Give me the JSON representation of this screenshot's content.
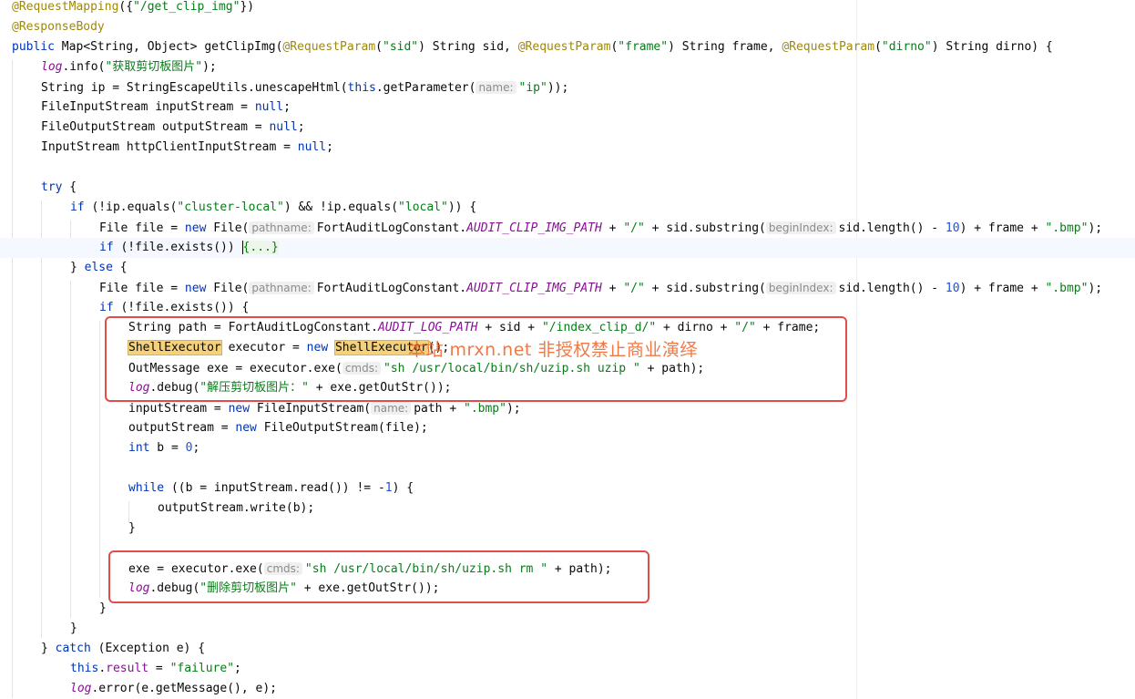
{
  "colors": {
    "keyword": "#0033b3",
    "string": "#067d17",
    "annotation": "#9e880d",
    "number": "#1750eb",
    "field": "#871094",
    "hint": "#8c8c8c",
    "highlight_box": "#e14d4d",
    "watermark": "#ec6226"
  },
  "watermark": {
    "text": "本站 mrxn.net 非授权禁止商业演绎"
  },
  "lines": [
    {
      "indent": 0,
      "tokens": [
        {
          "t": "@RequestMapping",
          "c": "ann"
        },
        {
          "t": "({"
        },
        {
          "t": "\"/get_clip_img\"",
          "c": "str"
        },
        {
          "t": "})"
        }
      ]
    },
    {
      "indent": 0,
      "tokens": [
        {
          "t": "@ResponseBody",
          "c": "ann"
        }
      ]
    },
    {
      "indent": 0,
      "tokens": [
        {
          "t": "public",
          "c": "kw"
        },
        {
          "t": " Map<String, Object> getClipImg("
        },
        {
          "t": "@RequestParam",
          "c": "ann"
        },
        {
          "t": "("
        },
        {
          "t": "\"sid\"",
          "c": "str"
        },
        {
          "t": ") String sid, "
        },
        {
          "t": "@RequestParam",
          "c": "ann"
        },
        {
          "t": "("
        },
        {
          "t": "\"frame\"",
          "c": "str"
        },
        {
          "t": ") String frame, "
        },
        {
          "t": "@RequestParam",
          "c": "ann"
        },
        {
          "t": "("
        },
        {
          "t": "\"dirno\"",
          "c": "str"
        },
        {
          "t": ") String dirno) {"
        }
      ]
    },
    {
      "indent": 1,
      "tokens": [
        {
          "t": "log",
          "c": "cst"
        },
        {
          "t": ".info("
        },
        {
          "t": "\"获取剪切板图片\"",
          "c": "str"
        },
        {
          "t": ");"
        }
      ]
    },
    {
      "indent": 1,
      "tokens": [
        {
          "t": "String ip = StringEscapeUtils.unescapeHtml("
        },
        {
          "t": "this",
          "c": "kw"
        },
        {
          "t": ".getParameter("
        },
        {
          "t": "name:",
          "c": "hint"
        },
        {
          "t": "\"ip\"",
          "c": "str"
        },
        {
          "t": "));"
        }
      ]
    },
    {
      "indent": 1,
      "tokens": [
        {
          "t": "FileInputStream inputStream = "
        },
        {
          "t": "null",
          "c": "kw"
        },
        {
          "t": ";"
        }
      ]
    },
    {
      "indent": 1,
      "tokens": [
        {
          "t": "FileOutputStream outputStream = "
        },
        {
          "t": "null",
          "c": "kw"
        },
        {
          "t": ";"
        }
      ]
    },
    {
      "indent": 1,
      "tokens": [
        {
          "t": "InputStream httpClientInputStream = "
        },
        {
          "t": "null",
          "c": "kw"
        },
        {
          "t": ";"
        }
      ]
    },
    {
      "indent": 0,
      "tokens": []
    },
    {
      "indent": 1,
      "tokens": [
        {
          "t": "try",
          "c": "kw"
        },
        {
          "t": " {"
        }
      ]
    },
    {
      "indent": 2,
      "tokens": [
        {
          "t": "if",
          "c": "kw"
        },
        {
          "t": " (!ip.equals("
        },
        {
          "t": "\"cluster-local\"",
          "c": "str"
        },
        {
          "t": ") && !ip.equals("
        },
        {
          "t": "\"local\"",
          "c": "str"
        },
        {
          "t": ")) {"
        }
      ]
    },
    {
      "indent": 3,
      "tokens": [
        {
          "t": "File file = "
        },
        {
          "t": "new",
          "c": "kw"
        },
        {
          "t": " File("
        },
        {
          "t": "pathname:",
          "c": "hint"
        },
        {
          "t": "FortAuditLogConstant."
        },
        {
          "t": "AUDIT_CLIP_IMG_PATH",
          "c": "cst"
        },
        {
          "t": " + "
        },
        {
          "t": "\"/\"",
          "c": "str"
        },
        {
          "t": " + sid.substring("
        },
        {
          "t": "beginIndex:",
          "c": "hint"
        },
        {
          "t": "sid.length() - "
        },
        {
          "t": "10",
          "c": "num"
        },
        {
          "t": ") + frame + "
        },
        {
          "t": "\".bmp\"",
          "c": "str"
        },
        {
          "t": ");"
        }
      ]
    },
    {
      "indent": 3,
      "current": true,
      "tokens": [
        {
          "t": "if",
          "c": "kw"
        },
        {
          "t": " (!file.exists()) "
        },
        {
          "t": "",
          "c": "caret"
        },
        {
          "t": "{...}",
          "c": "fold"
        }
      ]
    },
    {
      "indent": 2,
      "tokens": [
        {
          "t": "} "
        },
        {
          "t": "else",
          "c": "kw"
        },
        {
          "t": " {"
        }
      ]
    },
    {
      "indent": 3,
      "tokens": [
        {
          "t": "File file = "
        },
        {
          "t": "new",
          "c": "kw"
        },
        {
          "t": " File("
        },
        {
          "t": "pathname:",
          "c": "hint"
        },
        {
          "t": "FortAuditLogConstant."
        },
        {
          "t": "AUDIT_CLIP_IMG_PATH",
          "c": "cst"
        },
        {
          "t": " + "
        },
        {
          "t": "\"/\"",
          "c": "str"
        },
        {
          "t": " + sid.substring("
        },
        {
          "t": "beginIndex:",
          "c": "hint"
        },
        {
          "t": "sid.length() - "
        },
        {
          "t": "10",
          "c": "num"
        },
        {
          "t": ") + frame + "
        },
        {
          "t": "\".bmp\"",
          "c": "str"
        },
        {
          "t": ");"
        }
      ]
    },
    {
      "indent": 3,
      "tokens": [
        {
          "t": "if",
          "c": "kw"
        },
        {
          "t": " (!file.exists()) {"
        }
      ]
    },
    {
      "indent": 4,
      "tokens": [
        {
          "t": "String path = FortAuditLogConstant."
        },
        {
          "t": "AUDIT_LOG_PATH",
          "c": "cst"
        },
        {
          "t": " + sid + "
        },
        {
          "t": "\"/index_clip_d/\"",
          "c": "str"
        },
        {
          "t": " + dirno + "
        },
        {
          "t": "\"/\"",
          "c": "str"
        },
        {
          "t": " + frame;"
        }
      ]
    },
    {
      "indent": 4,
      "tokens": [
        {
          "t": "ShellExecutor",
          "c": "hl"
        },
        {
          "t": " executor = "
        },
        {
          "t": "new",
          "c": "kw"
        },
        {
          "t": " "
        },
        {
          "t": "ShellExecutor",
          "c": "hl"
        },
        {
          "t": "();"
        }
      ]
    },
    {
      "indent": 4,
      "tokens": [
        {
          "t": "OutMessage exe = executor.exe("
        },
        {
          "t": "cmds:",
          "c": "hint"
        },
        {
          "t": "\"sh /usr/local/bin/sh/uzip.sh uzip \"",
          "c": "str"
        },
        {
          "t": " + path);"
        }
      ]
    },
    {
      "indent": 4,
      "tokens": [
        {
          "t": "log",
          "c": "cst"
        },
        {
          "t": ".debug("
        },
        {
          "t": "\"解压剪切板图片：\"",
          "c": "str"
        },
        {
          "t": " + exe.getOutStr());"
        }
      ]
    },
    {
      "indent": 4,
      "tokens": [
        {
          "t": "inputStream = "
        },
        {
          "t": "new",
          "c": "kw"
        },
        {
          "t": " FileInputStream("
        },
        {
          "t": "name:",
          "c": "hint"
        },
        {
          "t": "path + "
        },
        {
          "t": "\".bmp\"",
          "c": "str"
        },
        {
          "t": ");"
        }
      ]
    },
    {
      "indent": 4,
      "tokens": [
        {
          "t": "outputStream = "
        },
        {
          "t": "new",
          "c": "kw"
        },
        {
          "t": " FileOutputStream(file);"
        }
      ]
    },
    {
      "indent": 4,
      "tokens": [
        {
          "t": "int",
          "c": "kw"
        },
        {
          "t": " b = "
        },
        {
          "t": "0",
          "c": "num"
        },
        {
          "t": ";"
        }
      ]
    },
    {
      "indent": 0,
      "tokens": []
    },
    {
      "indent": 4,
      "tokens": [
        {
          "t": "while",
          "c": "kw"
        },
        {
          "t": " ((b = inputStream.read()) != -"
        },
        {
          "t": "1",
          "c": "num"
        },
        {
          "t": ") {"
        }
      ]
    },
    {
      "indent": 5,
      "tokens": [
        {
          "t": "outputStream.write(b);"
        }
      ]
    },
    {
      "indent": 4,
      "tokens": [
        {
          "t": "}"
        }
      ]
    },
    {
      "indent": 0,
      "tokens": []
    },
    {
      "indent": 4,
      "tokens": [
        {
          "t": "exe = executor.exe("
        },
        {
          "t": "cmds:",
          "c": "hint"
        },
        {
          "t": "\"sh /usr/local/bin/sh/uzip.sh rm \"",
          "c": "str"
        },
        {
          "t": " + path);"
        }
      ]
    },
    {
      "indent": 4,
      "tokens": [
        {
          "t": "log",
          "c": "cst"
        },
        {
          "t": ".debug("
        },
        {
          "t": "\"删除剪切板图片\"",
          "c": "str"
        },
        {
          "t": " + exe.getOutStr());"
        }
      ]
    },
    {
      "indent": 3,
      "tokens": [
        {
          "t": "}"
        }
      ]
    },
    {
      "indent": 2,
      "tokens": [
        {
          "t": "}"
        }
      ]
    },
    {
      "indent": 1,
      "tokens": [
        {
          "t": "} "
        },
        {
          "t": "catch",
          "c": "kw"
        },
        {
          "t": " (Exception e) {"
        }
      ]
    },
    {
      "indent": 2,
      "tokens": [
        {
          "t": "this",
          "c": "kw"
        },
        {
          "t": "."
        },
        {
          "t": "result",
          "c": "fld"
        },
        {
          "t": " = "
        },
        {
          "t": "\"failure\"",
          "c": "str"
        },
        {
          "t": ";"
        }
      ]
    },
    {
      "indent": 2,
      "tokens": [
        {
          "t": "log",
          "c": "cst"
        },
        {
          "t": ".error(e.getMessage(), e);"
        }
      ]
    }
  ]
}
